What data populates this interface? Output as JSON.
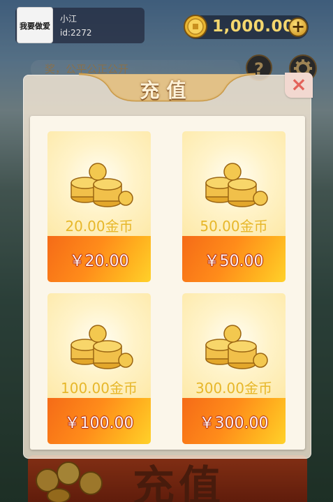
{
  "user": {
    "avatar_text": "我要做爱",
    "name": "小江",
    "id_label": "id:2272"
  },
  "wallet": {
    "balance": "1,000.00",
    "add_label": "+"
  },
  "background": {
    "marquee_text": "奖，公平公正公开",
    "help_label": "?",
    "bottom_banner_text": "充值"
  },
  "modal": {
    "title": "充值",
    "close_label": "×",
    "products": [
      {
        "amount": "20.00金币",
        "price": "￥20.00"
      },
      {
        "amount": "50.00金币",
        "price": "￥50.00"
      },
      {
        "amount": "100.00金币",
        "price": "￥100.00"
      },
      {
        "amount": "300.00金币",
        "price": "￥300.00"
      }
    ]
  },
  "colors": {
    "coin_gold": "#f5d76e",
    "price_orange": "#f56b17",
    "close_red": "#e3625a",
    "panel_cream": "#fbf6ea"
  },
  "icons": {
    "coin": "coin-icon",
    "plus": "plus-icon",
    "close": "close-icon",
    "help": "question-icon",
    "settings": "gear-icon",
    "coin_stack": "coin-stack-icon"
  }
}
